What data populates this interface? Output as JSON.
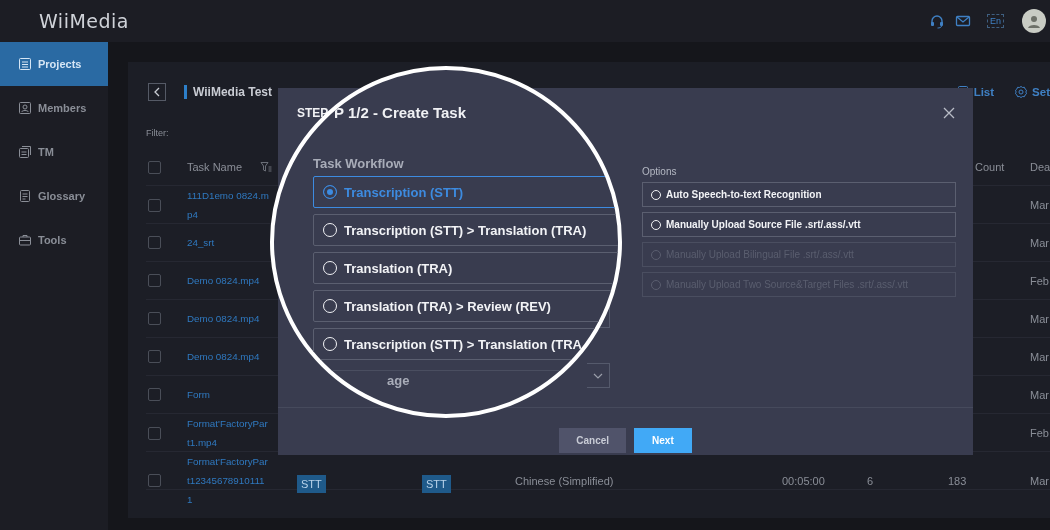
{
  "topbar": {
    "logo": "WiiMedia",
    "language": "En"
  },
  "sidebar": {
    "items": [
      {
        "label": "Projects",
        "selected": true
      },
      {
        "label": "Members",
        "selected": false
      },
      {
        "label": "TM",
        "selected": false
      },
      {
        "label": "Glossary",
        "selected": false
      },
      {
        "label": "Tools",
        "selected": false
      }
    ]
  },
  "project": {
    "title": "WiiMedia Test",
    "toolbar": [
      {
        "label": "List"
      },
      {
        "label": "Set"
      }
    ],
    "filter_label": "Filter:"
  },
  "table": {
    "headers": {
      "task_name": "Task Name",
      "count": "Count",
      "deadline": "Dea",
      "checked": false
    },
    "rows": [
      {
        "checked": false,
        "name": "111D1emo 0824.mp4",
        "deadline": "Mar"
      },
      {
        "checked": false,
        "name": "24_srt",
        "deadline": "Mar"
      },
      {
        "checked": false,
        "name": "Demo 0824.mp4",
        "deadline": "Feb"
      },
      {
        "checked": false,
        "name": "Demo 0824.mp4",
        "deadline": "Mar"
      },
      {
        "checked": false,
        "name": "Demo 0824.mp4",
        "deadline": "Mar"
      },
      {
        "checked": false,
        "name": "Form",
        "deadline": "Mar"
      },
      {
        "checked": false,
        "name": "Format'FactoryPart1.mp4",
        "deadline": "Feb"
      },
      {
        "checked": false,
        "name": "Format'FactoryPart123456789101111",
        "tag_1": "STT",
        "tag_2": "STT",
        "language": "Chinese (Simplified)",
        "duration": "00:05:00",
        "column_6": "6",
        "column_7": "183",
        "deadline": "Mar"
      }
    ]
  },
  "modal": {
    "title": "STEP",
    "options_label": "Options",
    "options": [
      {
        "label": "Auto Speech-to-text Recognition",
        "selected": false,
        "disabled": false
      },
      {
        "label": "Manually Upload Source File .srt/.ass/.vtt",
        "selected": false,
        "disabled": false
      },
      {
        "label": "Manually Upload Bilingual File .srt/.ass/.vtt",
        "selected": false,
        "disabled": true
      },
      {
        "label": "Manually Upload Two Source&Target Files .srt/.ass/.vtt",
        "selected": false,
        "disabled": true
      }
    ],
    "buttons": [
      {
        "label": "Cancel",
        "kind": "secondary"
      },
      {
        "label": "Next",
        "kind": "primary"
      }
    ]
  },
  "magnifier": {
    "title": "P 1/2 - Create Task",
    "workflow_label": "Task Workflow",
    "workflows": [
      {
        "label": "Transcription (STT)",
        "selected": true
      },
      {
        "label": "Transcription (STT) > Translation (TRA)",
        "selected": false
      },
      {
        "label": "Translation (TRA)",
        "selected": false
      },
      {
        "label": "Translation (TRA) > Review (REV)",
        "selected": false
      },
      {
        "label": "Transcription (STT) > Translation (TRA",
        "selected": false
      }
    ],
    "fragment": "age"
  }
}
